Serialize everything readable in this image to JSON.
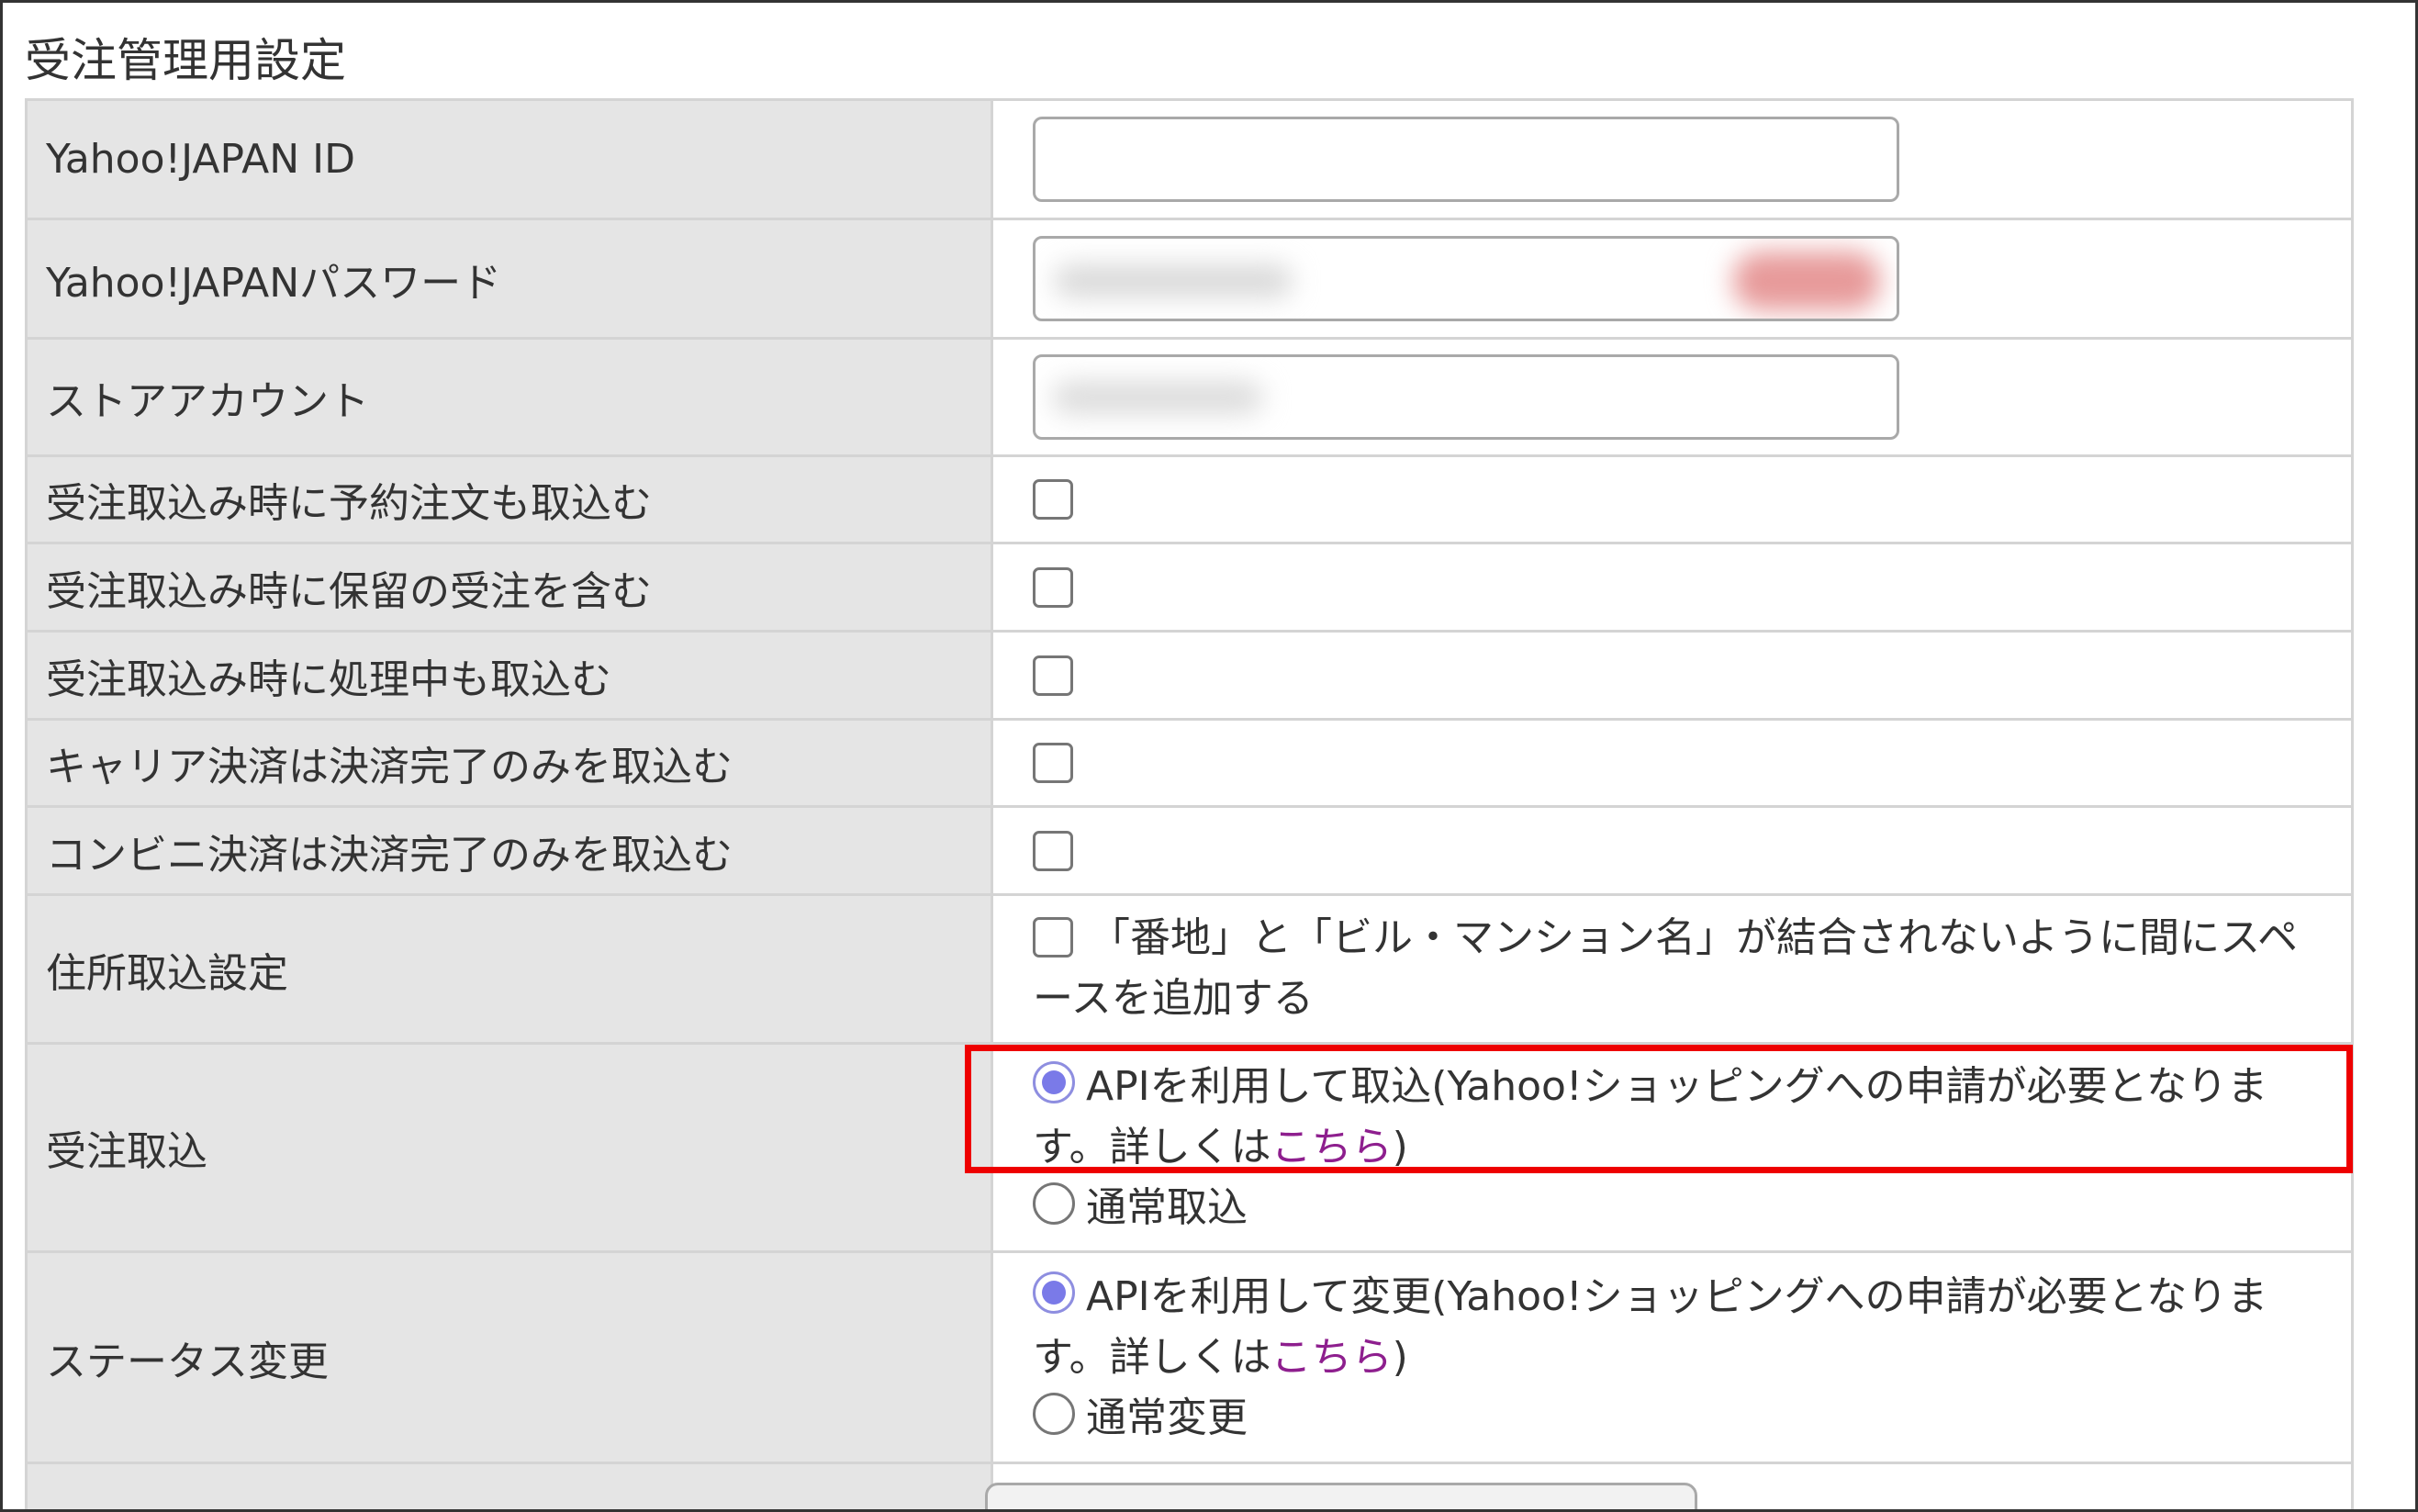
{
  "section": {
    "title": "受注管理用設定"
  },
  "rows": {
    "yahoo_id": {
      "label": "Yahoo!JAPAN ID",
      "value": ""
    },
    "yahoo_password": {
      "label": "Yahoo!JAPANパスワード"
    },
    "store_account": {
      "label": "ストアアカウント"
    },
    "reserve": {
      "label": "受注取込み時に予約注文も取込む",
      "checked": false
    },
    "hold": {
      "label": "受注取込み時に保留の受注を含む",
      "checked": false
    },
    "processing": {
      "label": "受注取込み時に処理中も取込む",
      "checked": false
    },
    "carrier": {
      "label": "キャリア決済は決済完了のみを取込む",
      "checked": false
    },
    "convenience": {
      "label": "コンビニ決済は決済完了のみを取込む",
      "checked": false
    },
    "address": {
      "label": "住所取込設定",
      "option_text": "「番地」と「ビル・マンション名」が結合されないように間にスペースを追加する",
      "checked": false
    },
    "order_import": {
      "label": "受注取込",
      "api_text": "APIを利用して取込(Yahoo!ショッピングへの申請が必要となります。詳しくは",
      "api_link": "こちら",
      "api_suffix": ")",
      "normal_text": "通常取込",
      "selected": "api"
    },
    "status_change": {
      "label": "ステータス変更",
      "api_text": "APIを利用して変更(Yahoo!ショッピングへの申請が必要となります。詳しくは",
      "api_link": "こちら",
      "api_suffix": ")",
      "normal_text": "通常変更",
      "selected": "api"
    }
  },
  "colors": {
    "label_bg": "#e5e5e5",
    "border": "#d4d4d4",
    "highlight": "#ee0000",
    "link": "#8e1f8e",
    "radio_selected": "#7a7ae8"
  }
}
